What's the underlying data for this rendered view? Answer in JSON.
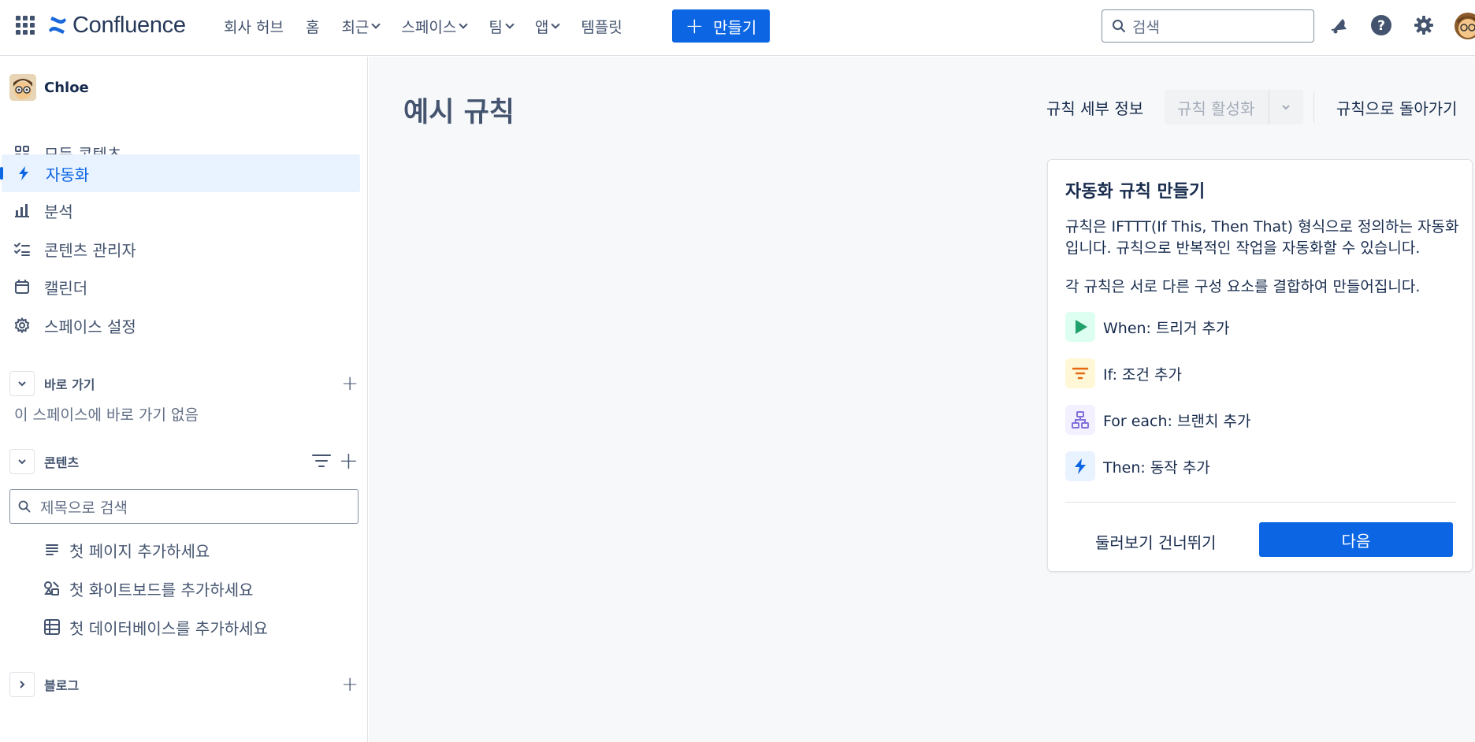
{
  "topnav": {
    "logo_text": "Confluence",
    "items": [
      {
        "label": "회사 허브",
        "dropdown": false
      },
      {
        "label": "홈",
        "dropdown": false
      },
      {
        "label": "최근",
        "dropdown": true
      },
      {
        "label": "스페이스",
        "dropdown": true
      },
      {
        "label": "팀",
        "dropdown": true
      },
      {
        "label": "앱",
        "dropdown": true
      },
      {
        "label": "템플릿",
        "dropdown": false
      }
    ],
    "create_label": "만들기",
    "search_placeholder": "검색",
    "icons": [
      "notifications-icon",
      "help-icon",
      "settings-icon",
      "avatar"
    ]
  },
  "sidebar": {
    "space_name": "Chloe",
    "items": [
      {
        "label": "모든 콘텐츠",
        "icon": "grid-icon",
        "active": false
      },
      {
        "label": "자동화",
        "icon": "lightning-icon",
        "active": true
      },
      {
        "label": "분석",
        "icon": "chart-icon",
        "active": false
      },
      {
        "label": "콘텐츠 관리자",
        "icon": "checklist-icon",
        "active": false
      },
      {
        "label": "캘린더",
        "icon": "calendar-icon",
        "active": false
      },
      {
        "label": "스페이스 설정",
        "icon": "gear-icon",
        "active": false
      }
    ],
    "shortcuts": {
      "title": "바로 가기",
      "empty": "이 스페이스에 바로 가기 없음"
    },
    "content": {
      "title": "콘텐츠",
      "search_placeholder": "제목으로 검색",
      "items": [
        {
          "label": "첫 페이지 추가하세요",
          "icon": "page-icon"
        },
        {
          "label": "첫 화이트보드를 추가하세요",
          "icon": "whiteboard-icon"
        },
        {
          "label": "첫 데이터베이스를 추가하세요",
          "icon": "database-icon"
        }
      ]
    },
    "blog": {
      "title": "블로그"
    }
  },
  "main": {
    "title": "예시 규칙",
    "rule_details": "규칙 세부 정보",
    "enable_rule": "규칙 활성화",
    "back_to_rules": "규칙으로 돌아가기",
    "card": {
      "title": "자동화 규칙 만들기",
      "description": "규칙은 IFTTT(If This, Then That) 형식으로 정의하는 자동화입니다. 규칙으로 반복적인 작업을 자동화할 수 있습니다.",
      "description2": "각 규칙은 서로 다른 구성 요소를 결합하여 만들어집니다.",
      "steps": [
        {
          "label": "When: 트리거 추가",
          "icon": "play-icon",
          "color": "#22A06B",
          "bg": "#DCFFF1"
        },
        {
          "label": "If: 조건 추가",
          "icon": "filter-icon",
          "color": "#E56910",
          "bg": "#FFF7D6"
        },
        {
          "label": "For each: 브랜치 추가",
          "icon": "branch-icon",
          "color": "#8270DB",
          "bg": "#F3F0FF"
        },
        {
          "label": "Then: 동작 추가",
          "icon": "lightning-icon",
          "color": "#0C66E4",
          "bg": "#E9F2FF"
        }
      ],
      "skip_label": "둘러보기 건너뛰기",
      "next_label": "다음"
    }
  },
  "colors": {
    "brand": "#0C66E4",
    "active_bg": "#E9F2FF",
    "main_bg": "#F7F8F9"
  }
}
